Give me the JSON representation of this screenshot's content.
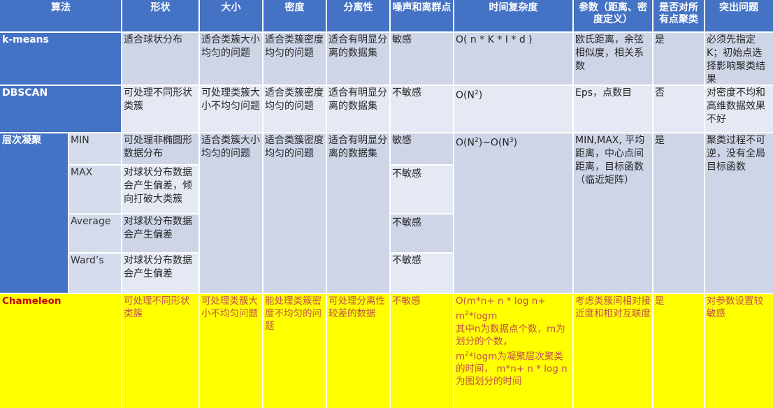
{
  "headers": [
    "算法",
    "形状",
    "大小",
    "密度",
    "分离性",
    "噪声和离群点",
    "时间复杂度",
    "参数（距离、密度定义）",
    "是否对所有点聚类",
    "突出问题"
  ],
  "rows": {
    "kmeans": {
      "name": "k-means",
      "shape": "适合球状分布",
      "size": "适合类簇大小均匀的问题",
      "density": "适合类簇密度均匀的问题",
      "separation": "适合有明显分离的数据集",
      "noise": "敏感",
      "complexity": "O( n * K * I * d )",
      "params": "欧氏距离，余弦相似度，相关系数",
      "all_points": "是",
      "issue": "必须先指定K；初始点选择影响聚类结果"
    },
    "dbscan": {
      "name": "DBSCAN",
      "shape": "可处理不同形状类簇",
      "size": "可处理类簇大小不均匀问题",
      "density": "适合类簇密度均匀的问题",
      "separation": "适合有明显分离的数据集",
      "noise": "不敏感",
      "complexity_base": "O(N",
      "complexity_exp": "2",
      "complexity_end": ")",
      "params": "Eps，点数目",
      "all_points": "否",
      "issue": "对密度不均和高维数据效果不好"
    },
    "hier": {
      "name": "层次凝聚",
      "size": "适合类簇大小均匀的问题",
      "density": "适合类簇密度均匀的问题",
      "separation": "适合有明显分离的数据集",
      "complexity": {
        "a": "O(N",
        "b": "2",
        "c": ")~O(N",
        "d": "3",
        "e": ")"
      },
      "params": "MIN,MAX, 平均距离，中心点间距离，目标函数（临近矩阵）",
      "all_points": "是",
      "issue": "聚类过程不可逆，没有全局目标函数",
      "subs": [
        {
          "name": "MIN",
          "shape": "可处理非椭圆形数据分布",
          "noise": "敏感"
        },
        {
          "name": "MAX",
          "shape": "对球状分布数据会产生偏差，倾向打破大类簇",
          "noise": "不敏感"
        },
        {
          "name": "Average",
          "shape": "对球状分布数据会产生偏差",
          "noise": "不敏感"
        },
        {
          "name": "Ward’s",
          "shape": "对球状分布数据会产生偏差",
          "noise": "不敏感"
        }
      ]
    },
    "chameleon": {
      "name": "Chameleon",
      "shape": "可处理不同形状类簇",
      "size": "可处理类簇大小不均匀问题",
      "density": "能处理类簇密度不均匀的问题",
      "separation": "可处理分离性较差的数据",
      "noise": "不敏感",
      "complexity": {
        "l1": "O(m*n+ n * log n+",
        "l2a": "m",
        "l2b": "2",
        "l2c": "*logm",
        "l3": "其中n为数据点个数，m为划分的个数，",
        "l4a": "m",
        "l4b": "2",
        "l4c": "*logm为凝聚层次聚类的时间，  m*n+ n * log n为图划分的时间"
      },
      "params": "考虑类簇间相对接近度和相对互联度",
      "all_points": "是",
      "issue": "对参数设置较敏感"
    }
  },
  "colors": {
    "header": "#4472c4",
    "light_row": "#e4e9f3",
    "dark_row": "#ced5e7",
    "highlight": "#ffff00",
    "highlight_text": "#c0504d"
  }
}
